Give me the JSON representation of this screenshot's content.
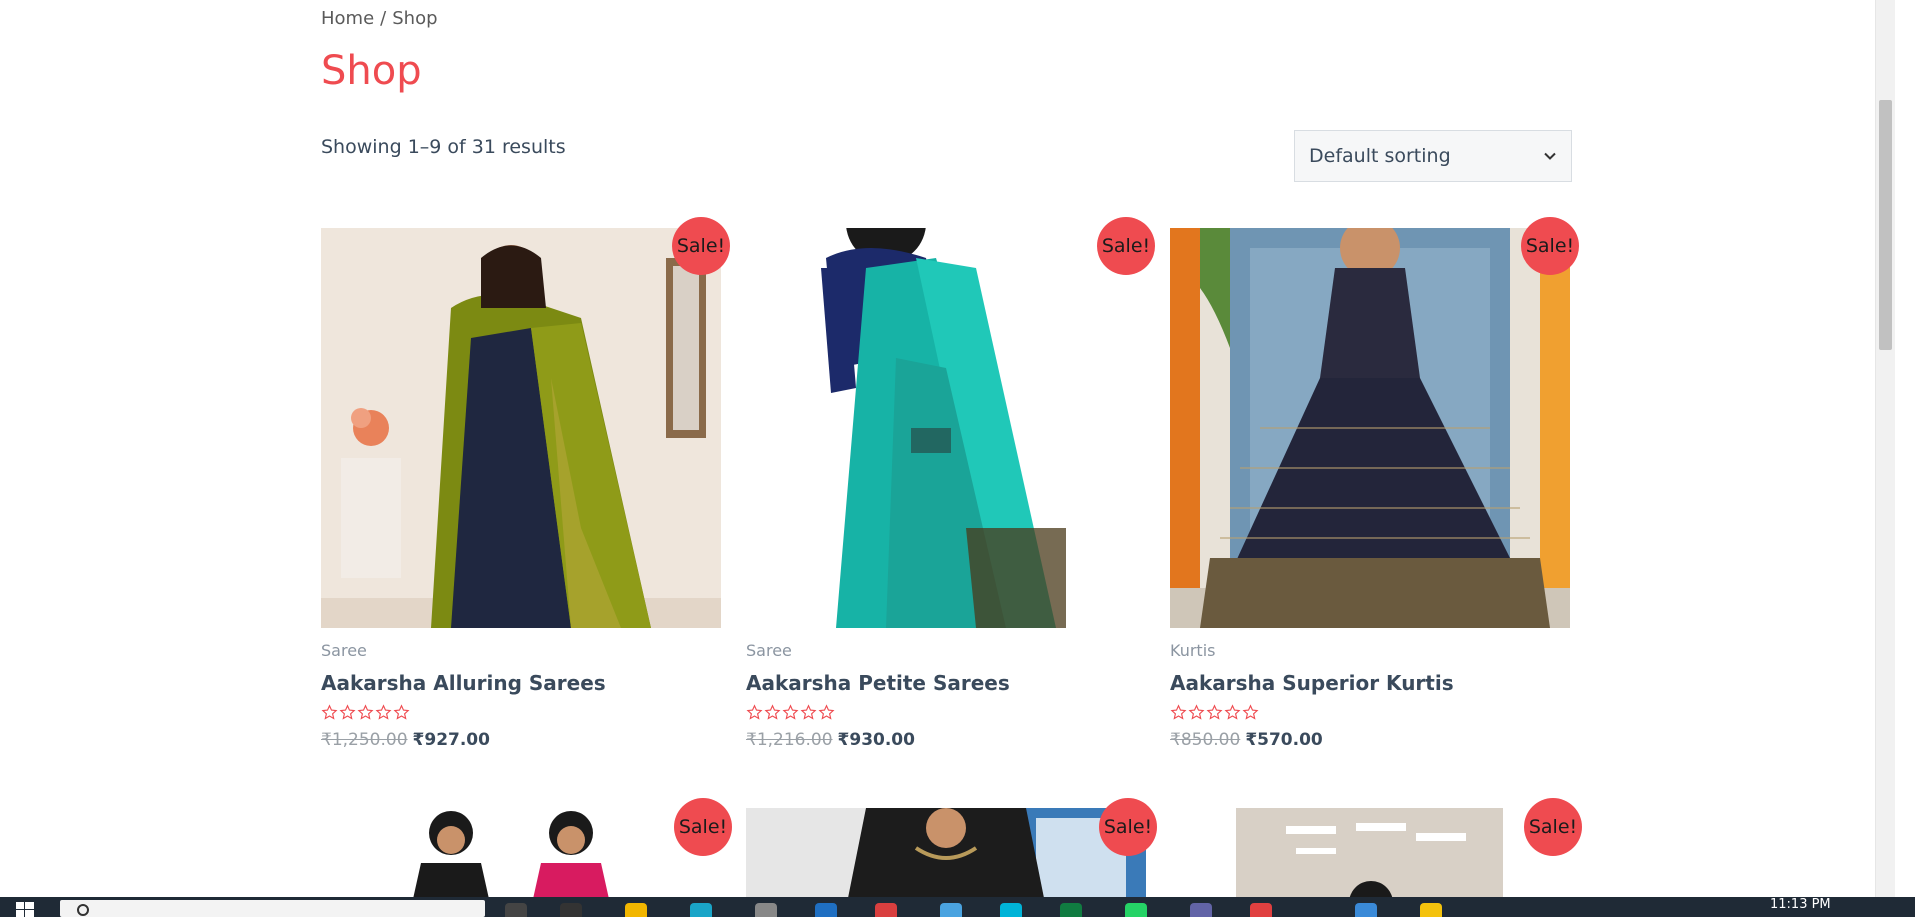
{
  "breadcrumb": {
    "home": "Home",
    "separator": "/",
    "current": "Shop"
  },
  "page_title": "Shop",
  "result_count": "Showing 1–9 of 31 results",
  "sorting": {
    "selected": "Default sorting"
  },
  "colors": {
    "accent": "#ef4b50",
    "text": "#3a4a5c",
    "muted": "#8b95a1"
  },
  "products": [
    {
      "badge": "Sale!",
      "category": "Saree",
      "name": "Aakarsha Alluring Sarees",
      "rating": 0,
      "old_price": "₹1,250.00",
      "new_price": "₹927.00"
    },
    {
      "badge": "Sale!",
      "category": "Saree",
      "name": "Aakarsha Petite Sarees",
      "rating": 0,
      "old_price": "₹1,216.00",
      "new_price": "₹930.00"
    },
    {
      "badge": "Sale!",
      "category": "Kurtis",
      "name": "Aakarsha Superior Kurtis",
      "rating": 0,
      "old_price": "₹850.00",
      "new_price": "₹570.00"
    }
  ],
  "next_row": [
    {
      "badge": "Sale!"
    },
    {
      "badge": "Sale!"
    },
    {
      "badge": "Sale!"
    }
  ],
  "taskbar": {
    "clock": "11:13 PM"
  }
}
